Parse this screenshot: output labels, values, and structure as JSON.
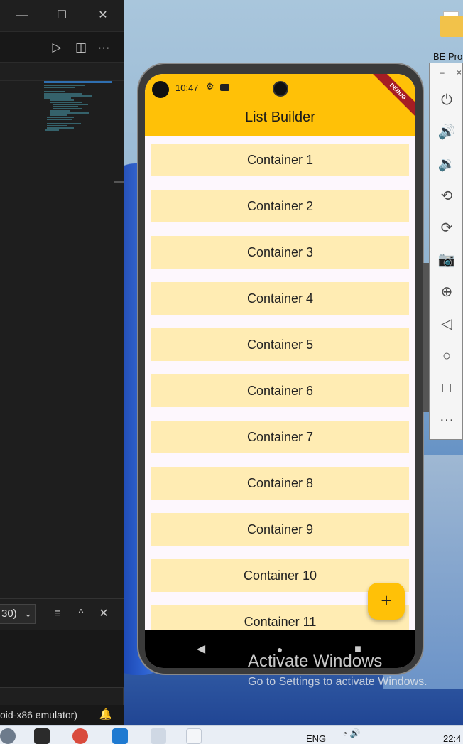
{
  "vscode": {
    "window_controls": {
      "minimize": "—",
      "maximize": "☐",
      "close": "✕"
    },
    "toolbar": {
      "run_icon": "▷",
      "split_icon": "◫",
      "more_icon": "···"
    },
    "panel": {
      "dropdown_value": "30)",
      "dropdown_chevron": "⌄",
      "clear_icon": "≡",
      "up_icon": "^",
      "close_icon": "✕"
    },
    "status": {
      "device_text": "oid-x86 emulator)",
      "bell_icon": "🔔"
    }
  },
  "desktop": {
    "folder_label": "BE Pro"
  },
  "phone": {
    "status_time": "10:47",
    "debug_banner": "DEBUG",
    "app_title": "List Builder",
    "items": [
      "Container 1",
      "Container 2",
      "Container 3",
      "Container 4",
      "Container 5",
      "Container 6",
      "Container 7",
      "Container 8",
      "Container 9",
      "Container 10",
      "Container 11"
    ],
    "fab_label": "+",
    "nav": {
      "back": "◀",
      "home": "●",
      "recents": "■"
    }
  },
  "emulator_toolbar": {
    "minimize": "–",
    "close": "×",
    "icons": [
      "⏻",
      "🔊",
      "🔉",
      "⟲",
      "⟳",
      "📷",
      "⊕",
      "◁",
      "○",
      "□",
      "···"
    ]
  },
  "watermark": {
    "line1": "Activate Windows",
    "line2": "Go to Settings to activate Windows."
  },
  "taskbar": {
    "language": "ENG",
    "clock": "22:4"
  },
  "colors": {
    "appbar": "#ffc107",
    "item_bg": "#ffecb3",
    "fab": "#ffc107",
    "debug": "#a61d24"
  }
}
